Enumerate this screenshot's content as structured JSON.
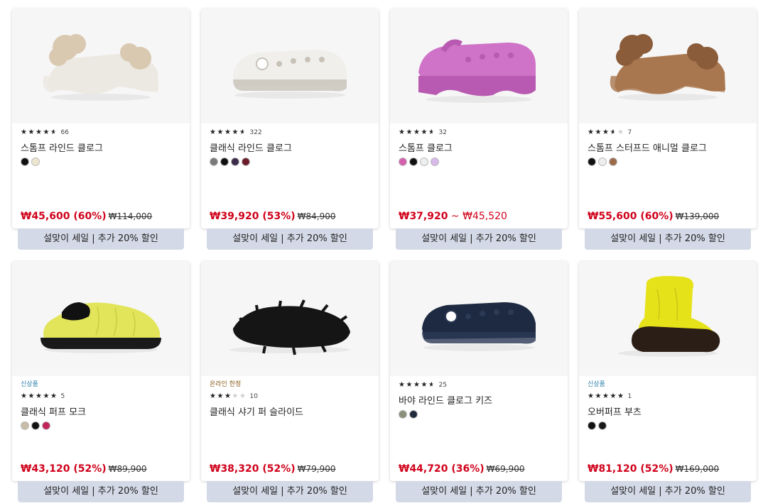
{
  "products": [
    {
      "badge": "",
      "rating": 4.5,
      "review_count": "66",
      "name": "스톰프 라인드 클로그",
      "swatches": [
        "#111111",
        "#ece6cf"
      ],
      "sale_price": "₩45,600 (60%)",
      "orig_price": "₩114,000",
      "range_end": "",
      "promo": "설맞이 세일 | 추가 20% 할인",
      "shoe_color": "#ece8e2",
      "accent": "#d9c9b0",
      "art": "fur-clog"
    },
    {
      "badge": "",
      "rating": 4.5,
      "review_count": "322",
      "name": "클래식 라인드 클로그",
      "swatches": [
        "#7a7a7a",
        "#111111",
        "#3b2a4a",
        "#6b1b2a"
      ],
      "sale_price": "₩39,920 (53%)",
      "orig_price": "₩84,900",
      "range_end": "",
      "promo": "설맞이 세일 | 추가 20% 할인",
      "shoe_color": "#f0efec",
      "accent": "#c8c2b8",
      "art": "clog"
    },
    {
      "badge": "",
      "rating": 4.5,
      "review_count": "32",
      "name": "스톰프 클로그",
      "swatches": [
        "#d45fae",
        "#111111",
        "#eeeeee",
        "#d9b8ea"
      ],
      "sale_price": "₩37,920",
      "orig_price": "",
      "range_end": "₩45,520",
      "promo": "설맞이 세일 | 추가 20% 할인",
      "shoe_color": "#cf73c8",
      "accent": "#b85ab1",
      "art": "platform-clog"
    },
    {
      "badge": "",
      "rating": 3.5,
      "review_count": "7",
      "name": "스톰프 스터프드 애니멀 클로그",
      "swatches": [
        "#111111",
        "#eeeeee",
        "#9b6a48"
      ],
      "sale_price": "₩55,600 (60%)",
      "orig_price": "₩139,000",
      "range_end": "",
      "promo": "설맞이 세일 | 추가 20% 할인",
      "shoe_color": "#a9774f",
      "accent": "#8a5c3a",
      "art": "fur-clog"
    },
    {
      "badge": "신상품",
      "rating": 5,
      "review_count": "5",
      "name": "클래식 퍼프 모크",
      "swatches": [
        "#c8bca7",
        "#111111",
        "#c0245a"
      ],
      "sale_price": "₩43,120 (52%)",
      "orig_price": "₩89,900",
      "range_end": "",
      "promo": "설맞이 세일 | 추가 20% 할인",
      "shoe_color": "#e2e55a",
      "accent": "#1a1a1a",
      "art": "moc"
    },
    {
      "badge": "온라인 한정",
      "rating": 3,
      "review_count": "10",
      "name": "클래식 샤기 퍼 슬라이드",
      "swatches": [],
      "sale_price": "₩38,320 (52%)",
      "orig_price": "₩79,900",
      "range_end": "",
      "promo": "설맞이 세일 | 추가 20% 할인",
      "shoe_color": "#151515",
      "accent": "#2a2a2a",
      "art": "slide"
    },
    {
      "badge": "",
      "rating": 4.5,
      "review_count": "25",
      "name": "바야 라인드 클로그 키즈",
      "swatches": [
        "#8a8f7a",
        "#1f2a3c"
      ],
      "sale_price": "₩44,720 (36%)",
      "orig_price": "₩69,900",
      "range_end": "",
      "promo": "설맞이 세일 | 추가 20% 할인",
      "shoe_color": "#1e2a42",
      "accent": "#2c3a55",
      "art": "clog"
    },
    {
      "badge": "신상품",
      "rating": 5,
      "review_count": "1",
      "name": "오버퍼프 부츠",
      "swatches": [
        "#111111",
        "#1a1a1a"
      ],
      "sale_price": "₩81,120 (52%)",
      "orig_price": "₩169,000",
      "range_end": "",
      "promo": "설맞이 세일 | 추가 20% 할인",
      "shoe_color": "#e6e21a",
      "accent": "#2b1e16",
      "art": "boot"
    }
  ],
  "colors": {
    "sale_red": "#d0021b",
    "promo_bg": "#d3d9e6",
    "badge_new": "#2a7fa8",
    "badge_online": "#8a5a1a"
  }
}
